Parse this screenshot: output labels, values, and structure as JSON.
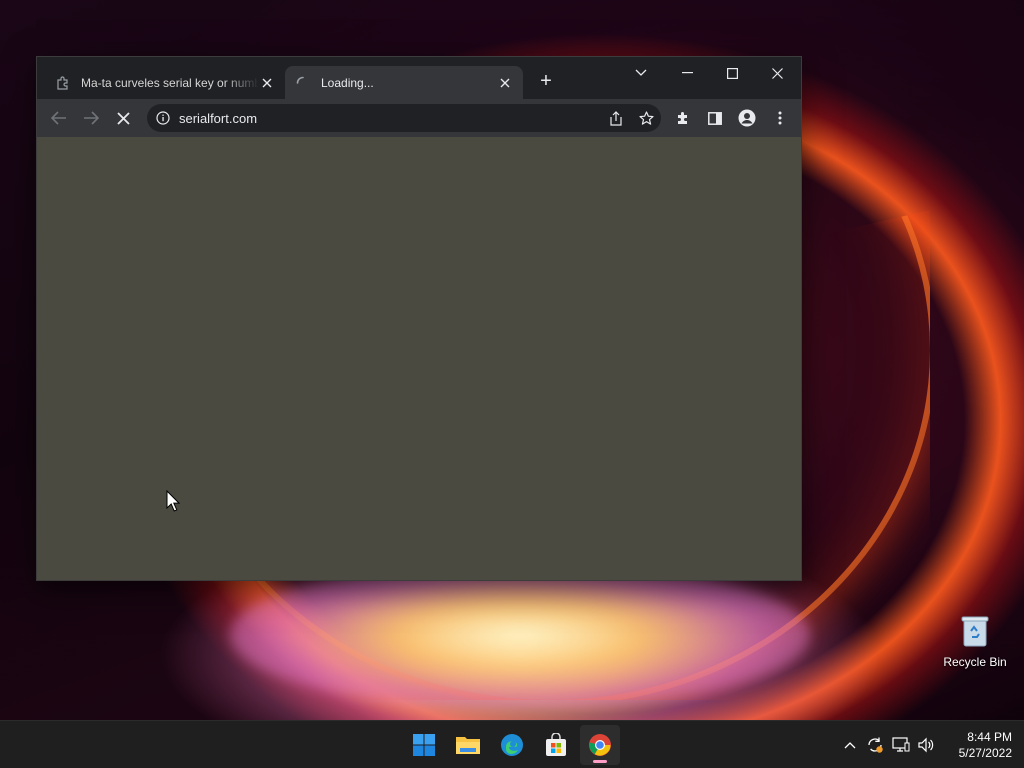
{
  "browser": {
    "tabs": [
      {
        "title": "Ma-ta curveles serial key or numb",
        "favicon": "puzzle-icon",
        "state": "inactive"
      },
      {
        "title": "Loading...",
        "favicon": "spinner-icon",
        "state": "active"
      }
    ],
    "new_tab_symbol": "+",
    "address": "serialfort.com",
    "toolbar_icons": [
      "back-icon",
      "forward-icon",
      "stop-icon",
      "info-icon",
      "share-icon",
      "star-icon",
      "extensions-icon",
      "sidepanel-icon",
      "profile-icon",
      "menu-icon"
    ],
    "content_color": "#4a4a40"
  },
  "desktop": {
    "recycle_bin_label": "Recycle Bin"
  },
  "taskbar": {
    "apps": [
      "start-icon",
      "file-explorer-icon",
      "edge-icon",
      "store-icon",
      "chrome-icon"
    ],
    "active_app": "chrome-icon",
    "tray_icons": [
      "chevron-up-icon",
      "sync-icon",
      "network-icon",
      "volume-icon"
    ],
    "time": "8:44 PM",
    "date": "5/27/2022"
  },
  "colors": {
    "tab_active": "#35363a",
    "titlebar": "#202124",
    "indicator": "#ff9ec6"
  }
}
